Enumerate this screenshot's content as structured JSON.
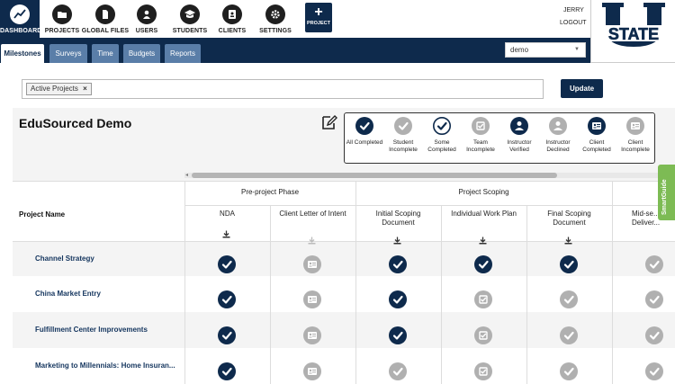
{
  "nav": {
    "items": [
      {
        "label": "DASHBOARD",
        "icon": "dashboard-chart-icon"
      },
      {
        "label": "PROJECTS",
        "icon": "folder-icon"
      },
      {
        "label": "GLOBAL FILES",
        "icon": "file-icon"
      },
      {
        "label": "USERS",
        "icon": "user-icon"
      },
      {
        "label": "STUDENTS",
        "icon": "graduation-cap-icon"
      },
      {
        "label": "CLIENTS",
        "icon": "badge-icon"
      },
      {
        "label": "SETTINGS",
        "icon": "gear-icon"
      }
    ],
    "add_project_label": "PROJECT",
    "user_name": "JERRY",
    "logout_label": "LOGOUT"
  },
  "logo": {
    "text": "STATE",
    "letter": "U"
  },
  "tabs": [
    "Milestones",
    "Surveys",
    "Time",
    "Budgets",
    "Reports"
  ],
  "active_tab": "Milestones",
  "org_select": {
    "value": "demo"
  },
  "filter": {
    "chip_label": "Active Projects",
    "chip_remove": "×",
    "update_label": "Update"
  },
  "project": {
    "title": "EduSourced Demo"
  },
  "legend": [
    {
      "label": "All Completed",
      "status": "complete"
    },
    {
      "label": "Student Incomplete",
      "status": "incomplete"
    },
    {
      "label": "Some Completed",
      "status": "some"
    },
    {
      "label": "Team Incomplete",
      "status": "team"
    },
    {
      "label": "Instructor Verified",
      "status": "inst-verified"
    },
    {
      "label": "Instructor Declined",
      "status": "inst-declined"
    },
    {
      "label": "Client Completed",
      "status": "client-complete"
    },
    {
      "label": "Client Incomplete",
      "status": "client-incomplete"
    }
  ],
  "table": {
    "project_name_header": "Project Name",
    "phases": [
      "Pre-project Phase",
      "Project Scoping"
    ],
    "columns": [
      "NDA",
      "Client Letter of Intent",
      "Initial Scoping Document",
      "Individual Work Plan",
      "Final Scoping Document",
      "Mid-se... Deliver..."
    ],
    "rows": [
      {
        "name": "Channel Strategy",
        "cells": [
          "complete",
          "client-incomplete",
          "complete",
          "complete",
          "complete",
          "incomplete"
        ]
      },
      {
        "name": "China Market Entry",
        "cells": [
          "complete",
          "client-incomplete",
          "complete",
          "team",
          "incomplete",
          "incomplete"
        ]
      },
      {
        "name": "Fulfillment Center Improvements",
        "cells": [
          "complete",
          "client-incomplete",
          "complete",
          "team",
          "incomplete",
          "incomplete"
        ]
      },
      {
        "name": "Marketing to Millennials: Home Insuran...",
        "cells": [
          "complete",
          "client-incomplete",
          "incomplete",
          "team",
          "incomplete",
          "incomplete"
        ]
      }
    ]
  },
  "smartguide_label": "SmartGuide",
  "colors": {
    "navy": "#0e2a4c",
    "tab_inactive": "#5a7ea8",
    "gray_icon": "#b0b0b0",
    "green": "#7dbb54"
  }
}
